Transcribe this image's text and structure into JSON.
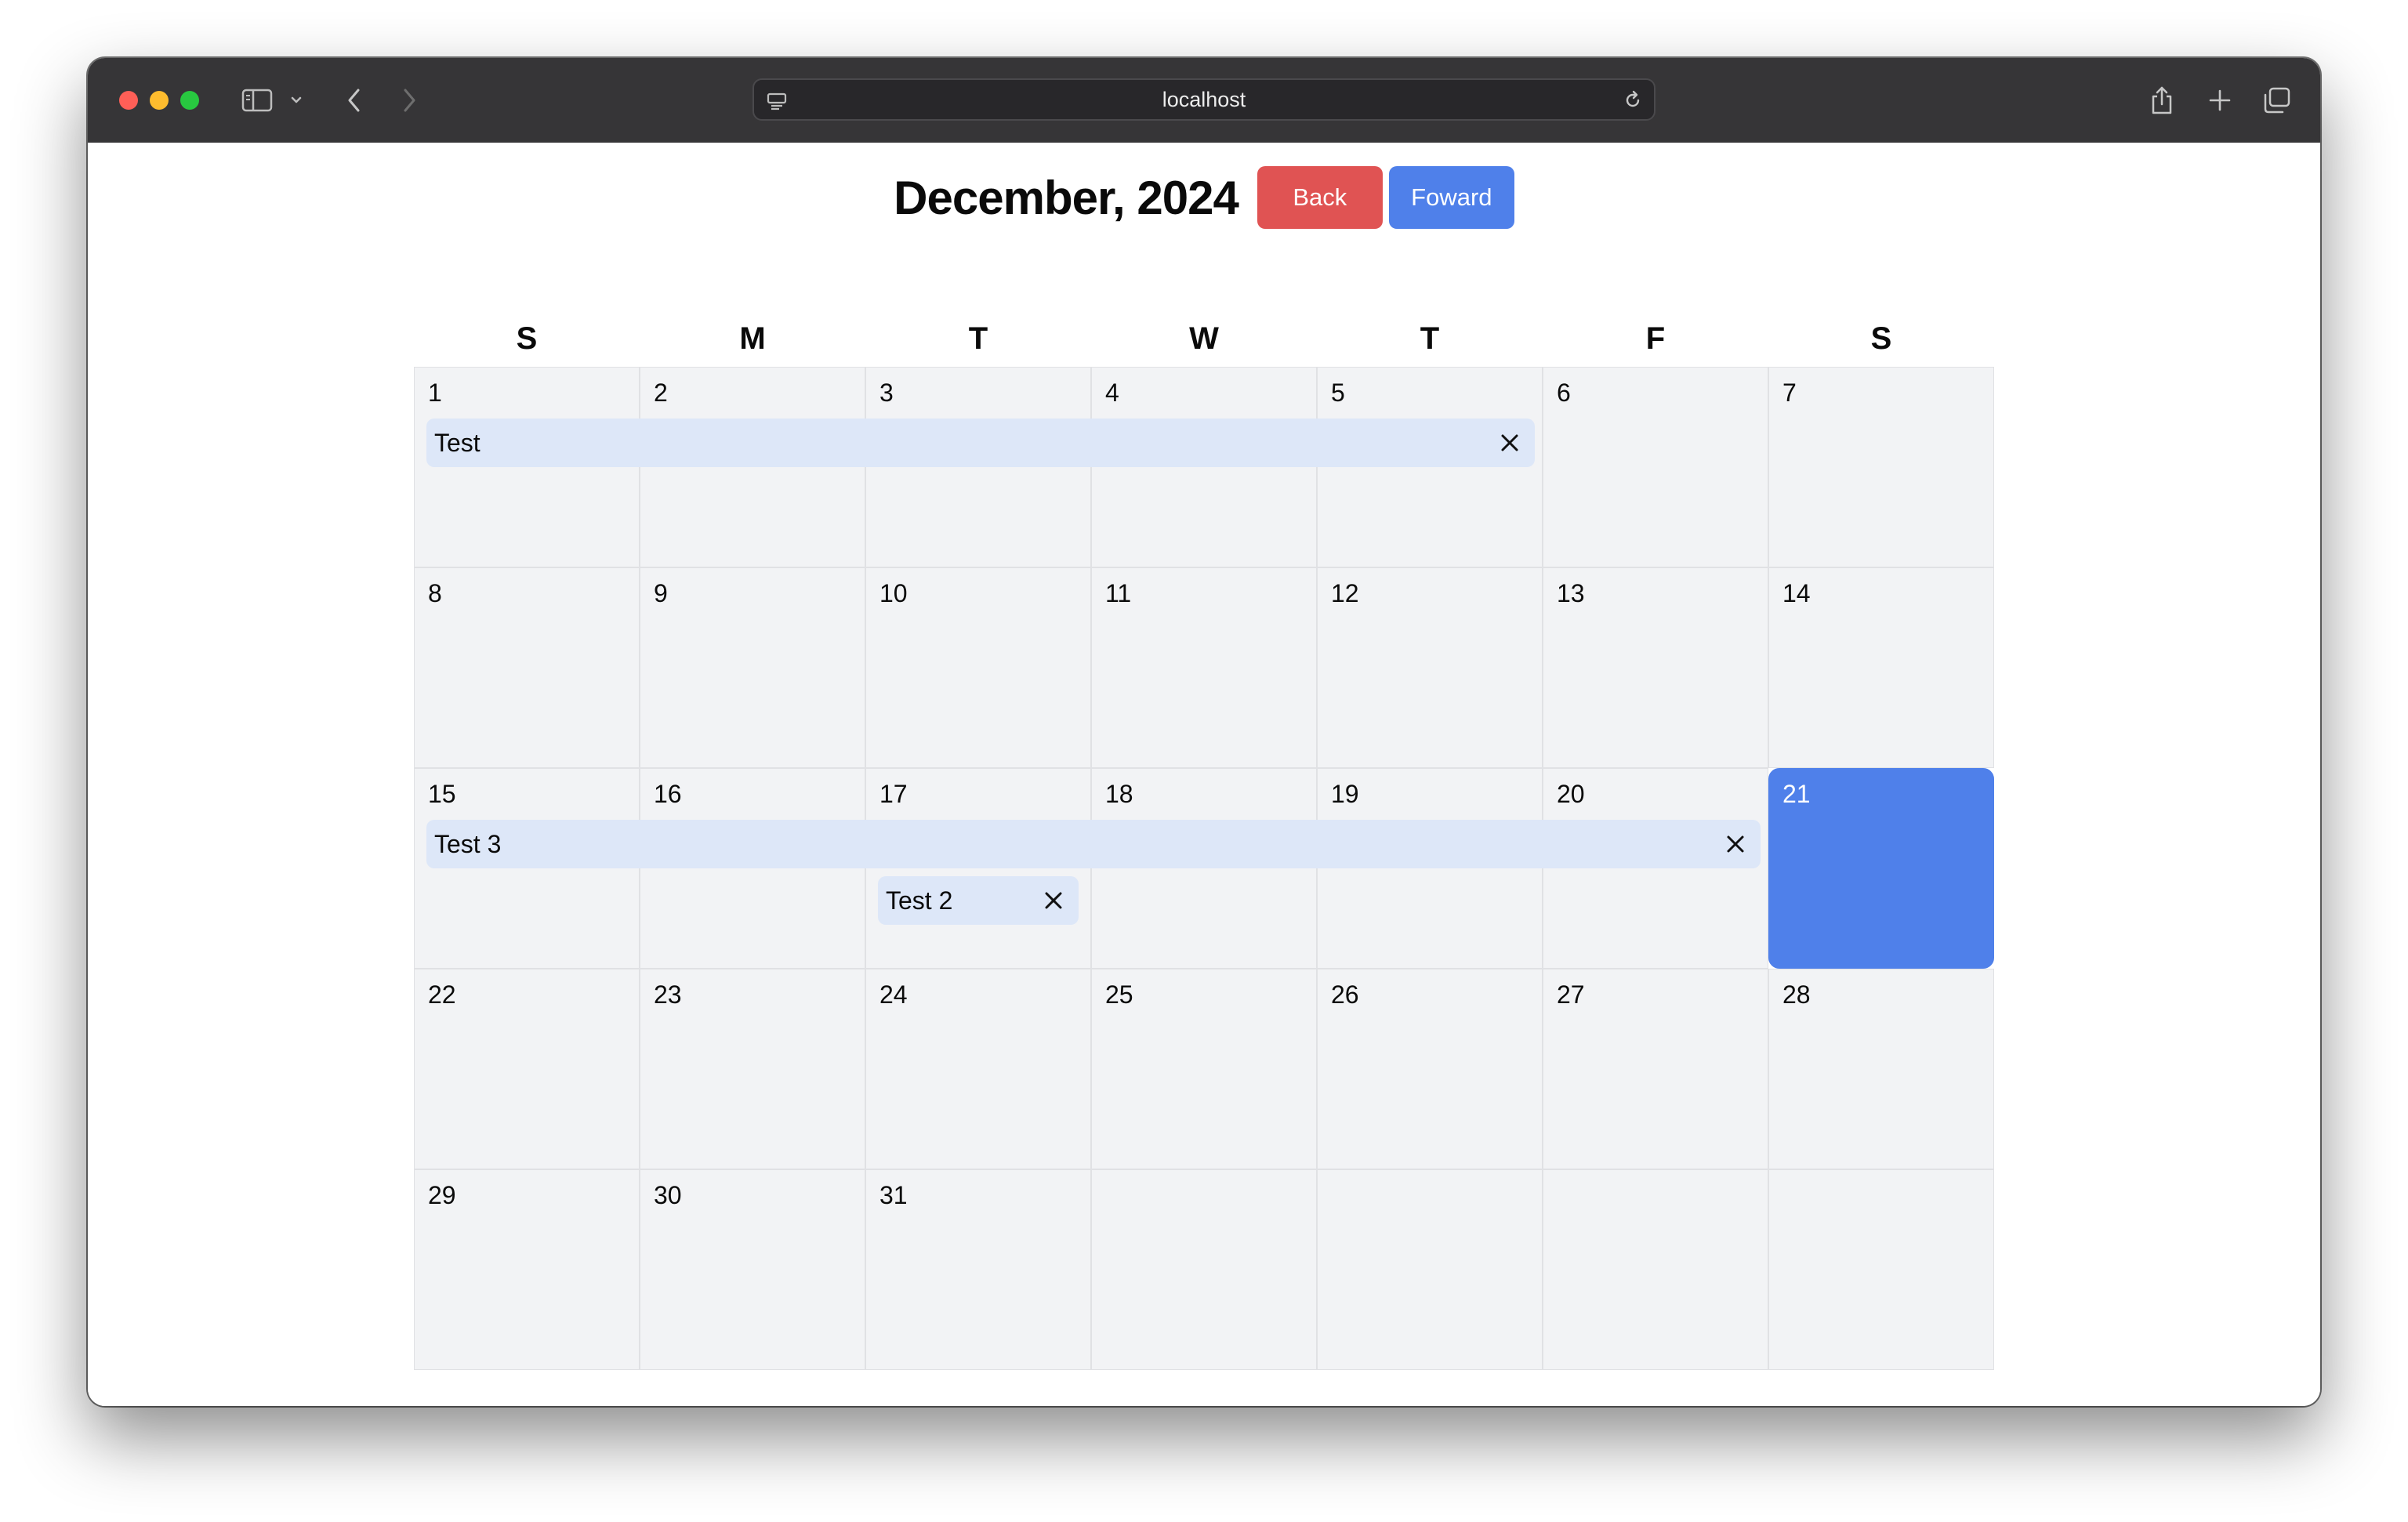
{
  "browser": {
    "url": "localhost"
  },
  "header": {
    "title": "December, 2024",
    "back_label": "Back",
    "forward_label": "Foward",
    "colors": {
      "back": "#e05353",
      "forward": "#4f80ea"
    }
  },
  "weekdays": [
    "S",
    "M",
    "T",
    "W",
    "T",
    "F",
    "S"
  ],
  "weeks": [
    [
      "1",
      "2",
      "3",
      "4",
      "5",
      "6",
      "7"
    ],
    [
      "8",
      "9",
      "10",
      "11",
      "12",
      "13",
      "14"
    ],
    [
      "15",
      "16",
      "17",
      "18",
      "19",
      "20",
      "21"
    ],
    [
      "22",
      "23",
      "24",
      "25",
      "26",
      "27",
      "28"
    ],
    [
      "29",
      "30",
      "31",
      "",
      "",
      "",
      ""
    ]
  ],
  "today": "21",
  "events": [
    {
      "label": "Test",
      "start_day": "1",
      "end_day": "5"
    },
    {
      "label": "Test 3",
      "start_day": "15",
      "end_day": "20"
    },
    {
      "label": "Test 2",
      "start_day": "17",
      "end_day": "17"
    }
  ],
  "colors": {
    "cell_background": "#f2f3f5",
    "today_highlight": "#4f80ea",
    "event_background": "#dde7f8"
  },
  "icons": {
    "sidebar": "sidebar-icon",
    "back": "chevron-left-icon",
    "forward": "chevron-right-icon",
    "share": "share-icon",
    "new_tab": "plus-icon",
    "tabs": "tabs-overview-icon",
    "reload": "reload-icon",
    "delete_event": "close-icon"
  }
}
